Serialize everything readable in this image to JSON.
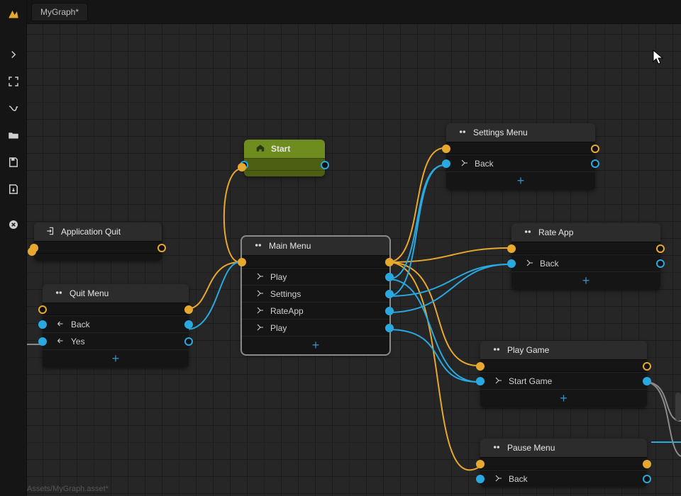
{
  "tab": {
    "title": "MyGraph*"
  },
  "statusPath": "Assets/MyGraph.asset*",
  "sidebar": {
    "items": [
      {
        "name": "logo-icon"
      },
      {
        "name": "chevron-right-icon"
      },
      {
        "name": "fit-icon"
      },
      {
        "name": "flow-icon"
      },
      {
        "name": "folder-icon"
      },
      {
        "name": "save-icon"
      },
      {
        "name": "export-icon"
      },
      {
        "name": "close-icon"
      }
    ]
  },
  "addLabel": "+",
  "nodes": {
    "start": {
      "title": "Start"
    },
    "appQuit": {
      "title": "Application Quit"
    },
    "quitMenu": {
      "title": "Quit Menu",
      "rows": [
        "Back",
        "Yes"
      ]
    },
    "mainMenu": {
      "title": "Main Menu",
      "rows": [
        "Play",
        "Settings",
        "RateApp",
        "Play"
      ]
    },
    "settings": {
      "title": "Settings Menu",
      "rows": [
        "Back"
      ]
    },
    "rateApp": {
      "title": "Rate App",
      "rows": [
        "Back"
      ]
    },
    "playGame": {
      "title": "Play Game",
      "rows": [
        "Start Game"
      ]
    },
    "pauseMenu": {
      "title": "Pause Menu",
      "rows": [
        "Back"
      ]
    }
  },
  "colors": {
    "orange": "#e7a82f",
    "blue": "#2aa8e0",
    "gray": "#8a8a8a"
  }
}
